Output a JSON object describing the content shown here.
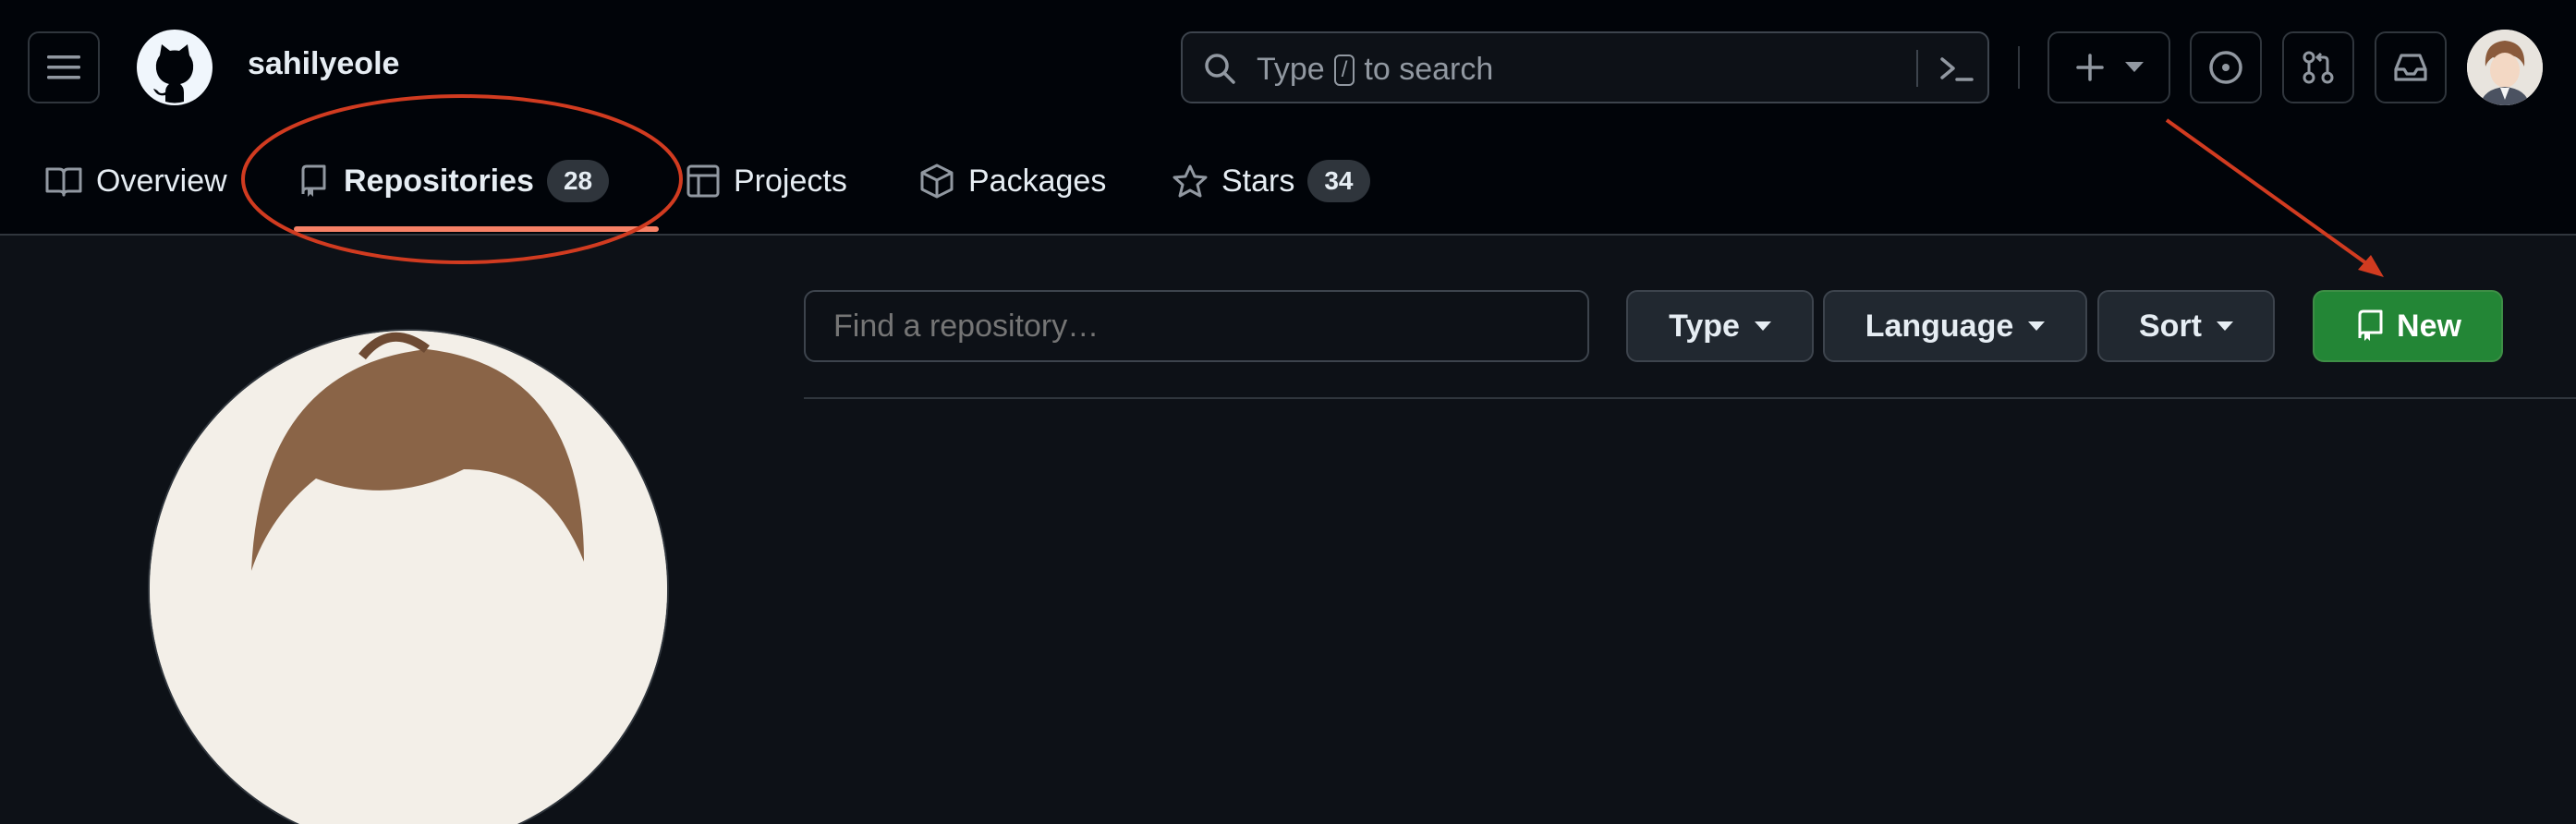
{
  "header": {
    "username": "sahilyeole",
    "search": {
      "prefix": "Type",
      "key": "/",
      "suffix": "to search"
    }
  },
  "icons": {
    "menu": "hamburger-icon",
    "logo": "github-octocat-icon",
    "search": "search-icon",
    "command": "command-palette-icon",
    "plus": "plus-icon",
    "issues": "issue-circle-icon",
    "pulls": "pull-request-icon",
    "inbox": "inbox-icon"
  },
  "tabs": [
    {
      "label": "Overview",
      "icon": "book-icon"
    },
    {
      "label": "Repositories",
      "icon": "repo-icon",
      "count": "28",
      "selected": true
    },
    {
      "label": "Projects",
      "icon": "table-icon"
    },
    {
      "label": "Packages",
      "icon": "package-icon"
    },
    {
      "label": "Stars",
      "icon": "star-icon",
      "count": "34"
    }
  ],
  "repo_filter": {
    "placeholder": "Find a repository…",
    "type_label": "Type",
    "language_label": "Language",
    "sort_label": "Sort",
    "new_label": "New"
  },
  "colors": {
    "accent_underline": "#f78166",
    "new_button": "#238636",
    "annotation": "#d13b20"
  }
}
